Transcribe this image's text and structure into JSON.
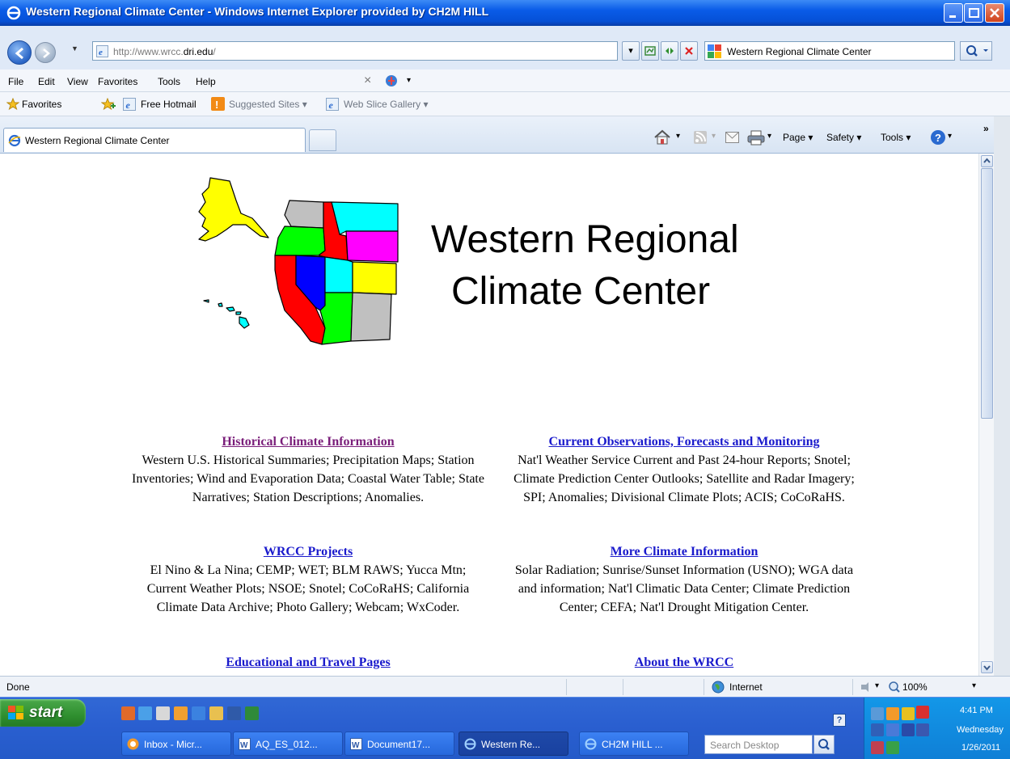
{
  "window": {
    "title": "Western Regional Climate Center - Windows Internet Explorer provided by CH2M HILL"
  },
  "address_bar": {
    "url_prefix": "http://www.wrcc.",
    "url_domain": "dri.edu",
    "url_suffix": "/",
    "search_text": "Western Regional Climate Center"
  },
  "menu": {
    "items": [
      "File",
      "Edit",
      "View",
      "Favorites",
      "Tools",
      "Help"
    ]
  },
  "favorites_bar": {
    "favorites_label": "Favorites",
    "items": [
      {
        "label": "Free Hotmail"
      },
      {
        "label": "Suggested Sites ▾"
      },
      {
        "label": "Web Slice Gallery ▾"
      }
    ]
  },
  "tabs": {
    "active_label": "Western Regional Climate Center"
  },
  "command_bar": {
    "page": "Page ▾",
    "safety": "Safety ▾",
    "tools": "Tools ▾"
  },
  "content": {
    "headline_line1": "Western Regional",
    "headline_line2": "Climate Center",
    "sections": [
      {
        "heading": "Historical Climate Information",
        "description": "Western U.S. Historical Summaries; Precipitation Maps; Station Inventories; Wind and Evaporation Data; Coastal Water Table; State Narratives; Station Descriptions; Anomalies."
      },
      {
        "heading": "Current Observations, Forecasts and Monitoring",
        "description": "Nat'l Weather Service Current and Past 24-hour Reports; Snotel; Climate Prediction Center Outlooks; Satellite and Radar Imagery; SPI; Anomalies; Divisional Climate Plots; ACIS; CoCoRaHS."
      },
      {
        "heading": "WRCC Projects",
        "description": "El Nino & La Nina; CEMP; WET; BLM RAWS; Yucca Mtn; Current Weather Plots; NSOE; Snotel; CoCoRaHS; California Climate Data Archive; Photo Gallery; Webcam; WxCoder."
      },
      {
        "heading": "More Climate Information",
        "description": "Solar Radiation; Sunrise/Sunset Information (USNO); WGA data and information; Nat'l Climatic Data Center; Climate Prediction Center; CEFA; Nat'l Drought Mitigation Center."
      },
      {
        "heading": "Educational and Travel Pages",
        "description": ""
      },
      {
        "heading": "About the WRCC",
        "description": ""
      }
    ]
  },
  "status_bar": {
    "status": "Done",
    "zone": "Internet",
    "zoom": "100%"
  },
  "taskbar": {
    "start_label": "start",
    "buttons": [
      {
        "label": "Inbox - Micr..."
      },
      {
        "label": "AQ_ES_012..."
      },
      {
        "label": "Document17..."
      },
      {
        "label": "Western Re..."
      },
      {
        "label": "CH2M HILL ..."
      }
    ],
    "search_placeholder": "Search Desktop",
    "clock_time": "4:41 PM",
    "clock_day": "Wednesday",
    "clock_date": "1/26/2011"
  },
  "colors": {
    "title_bar": "#0a5ce8",
    "link": "#1a1acc",
    "visited_link": "#7a1e7a",
    "taskbar": "#245ac8",
    "start_button": "#2f8f2f"
  }
}
